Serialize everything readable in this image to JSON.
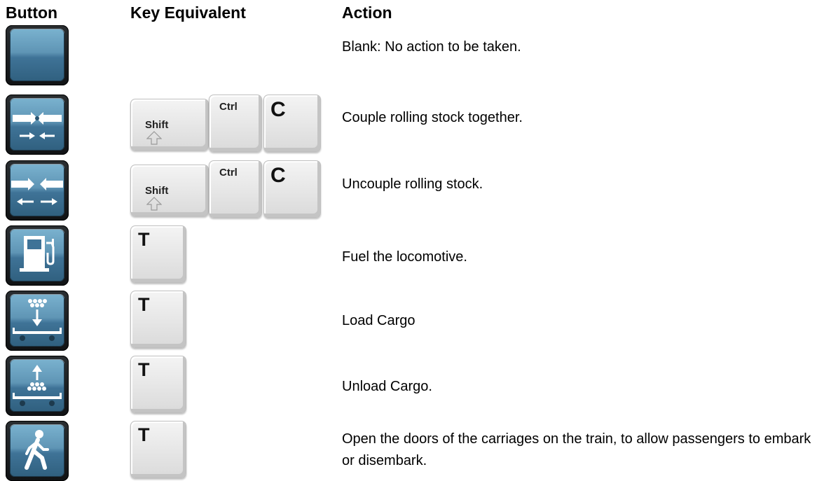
{
  "headers": {
    "button": "Button",
    "key": "Key Equivalent",
    "action": "Action"
  },
  "rows": [
    {
      "icon": "blank-button-icon",
      "keys": [],
      "action": "Blank: No action to be taken."
    },
    {
      "icon": "couple-icon",
      "keys": [
        "Shift",
        "Ctrl",
        "C"
      ],
      "action": "Couple rolling stock together."
    },
    {
      "icon": "uncouple-icon",
      "keys": [
        "Shift",
        "Ctrl",
        "C"
      ],
      "action": "Uncouple rolling stock."
    },
    {
      "icon": "fuel-pump-icon",
      "keys": [
        "T"
      ],
      "action": "Fuel the locomotive."
    },
    {
      "icon": "load-cargo-icon",
      "keys": [
        "T"
      ],
      "action": "Load Cargo"
    },
    {
      "icon": "unload-cargo-icon",
      "keys": [
        "T"
      ],
      "action": "Unload Cargo."
    },
    {
      "icon": "walking-passenger-icon",
      "keys": [
        "T"
      ],
      "action": "Open the doors of the carriages on the train, to allow passengers to embark or disembark."
    }
  ],
  "colors": {
    "tile_blue": "#5f95b5",
    "tile_frame": "#1a1c1e",
    "key_face": "#e6e6e6"
  }
}
